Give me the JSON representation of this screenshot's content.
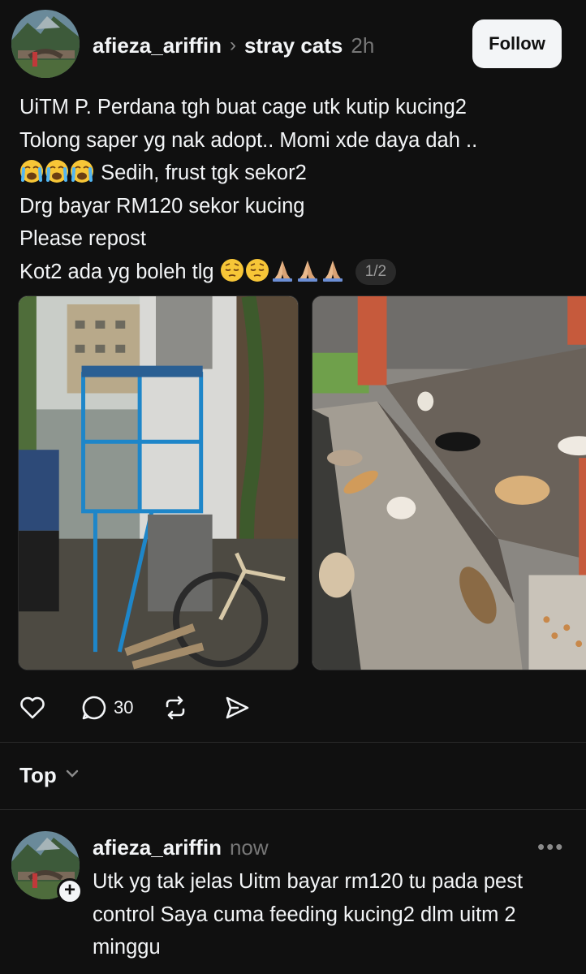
{
  "post": {
    "author": "afieza_ariffin",
    "separator": "›",
    "community": "stray cats",
    "time": "2h",
    "follow_label": "Follow",
    "text_lines": [
      "UiTM P. Perdana tgh buat cage utk kutip kucing2",
      "Tolong saper yg nak adopt.. Momi xde daya dah ..",
      " Sedih, frust tgk sekor2",
      "Drg bayar RM120 sekor kucing",
      "Please repost",
      "Kot2 ada yg boleh tlg "
    ],
    "image_counter": "1/2",
    "images": [
      {
        "icon": "photo-cage-bicycle"
      },
      {
        "icon": "photo-cats-feeding"
      }
    ],
    "emoji": {
      "line3": [
        "loudly-crying-face-icon",
        "loudly-crying-face-icon",
        "loudly-crying-face-icon"
      ],
      "line6": [
        "relieved-face-icon",
        "relieved-face-icon",
        "folded-hands-icon",
        "folded-hands-icon",
        "folded-hands-icon"
      ]
    }
  },
  "actions": {
    "like_count": "",
    "reply_count": "30",
    "repost_count": "",
    "share_count": ""
  },
  "sort": {
    "label": "Top"
  },
  "reply": {
    "author": "afieza_ariffin",
    "time": "now",
    "more": "•••",
    "text": "Utk yg tak jelas Uitm bayar rm120 tu pada pest control Saya cuma feeding kucing2 dlm uitm 2 minggu"
  },
  "colors": {
    "background": "#101010",
    "text": "#f3f5f7",
    "muted": "#777777",
    "follow_bg": "#f3f5f7"
  }
}
